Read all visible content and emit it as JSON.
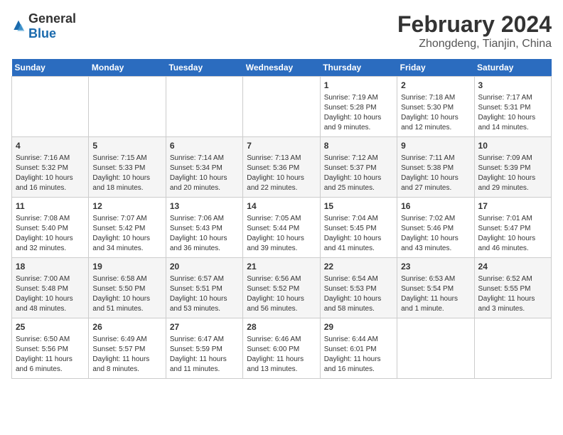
{
  "header": {
    "logo_general": "General",
    "logo_blue": "Blue",
    "title": "February 2024",
    "subtitle": "Zhongdeng, Tianjin, China"
  },
  "days_of_week": [
    "Sunday",
    "Monday",
    "Tuesday",
    "Wednesday",
    "Thursday",
    "Friday",
    "Saturday"
  ],
  "weeks": [
    [
      {
        "date": "",
        "content": ""
      },
      {
        "date": "",
        "content": ""
      },
      {
        "date": "",
        "content": ""
      },
      {
        "date": "",
        "content": ""
      },
      {
        "date": "1",
        "content": "Sunrise: 7:19 AM\nSunset: 5:28 PM\nDaylight: 10 hours\nand 9 minutes."
      },
      {
        "date": "2",
        "content": "Sunrise: 7:18 AM\nSunset: 5:30 PM\nDaylight: 10 hours\nand 12 minutes."
      },
      {
        "date": "3",
        "content": "Sunrise: 7:17 AM\nSunset: 5:31 PM\nDaylight: 10 hours\nand 14 minutes."
      }
    ],
    [
      {
        "date": "4",
        "content": "Sunrise: 7:16 AM\nSunset: 5:32 PM\nDaylight: 10 hours\nand 16 minutes."
      },
      {
        "date": "5",
        "content": "Sunrise: 7:15 AM\nSunset: 5:33 PM\nDaylight: 10 hours\nand 18 minutes."
      },
      {
        "date": "6",
        "content": "Sunrise: 7:14 AM\nSunset: 5:34 PM\nDaylight: 10 hours\nand 20 minutes."
      },
      {
        "date": "7",
        "content": "Sunrise: 7:13 AM\nSunset: 5:36 PM\nDaylight: 10 hours\nand 22 minutes."
      },
      {
        "date": "8",
        "content": "Sunrise: 7:12 AM\nSunset: 5:37 PM\nDaylight: 10 hours\nand 25 minutes."
      },
      {
        "date": "9",
        "content": "Sunrise: 7:11 AM\nSunset: 5:38 PM\nDaylight: 10 hours\nand 27 minutes."
      },
      {
        "date": "10",
        "content": "Sunrise: 7:09 AM\nSunset: 5:39 PM\nDaylight: 10 hours\nand 29 minutes."
      }
    ],
    [
      {
        "date": "11",
        "content": "Sunrise: 7:08 AM\nSunset: 5:40 PM\nDaylight: 10 hours\nand 32 minutes."
      },
      {
        "date": "12",
        "content": "Sunrise: 7:07 AM\nSunset: 5:42 PM\nDaylight: 10 hours\nand 34 minutes."
      },
      {
        "date": "13",
        "content": "Sunrise: 7:06 AM\nSunset: 5:43 PM\nDaylight: 10 hours\nand 36 minutes."
      },
      {
        "date": "14",
        "content": "Sunrise: 7:05 AM\nSunset: 5:44 PM\nDaylight: 10 hours\nand 39 minutes."
      },
      {
        "date": "15",
        "content": "Sunrise: 7:04 AM\nSunset: 5:45 PM\nDaylight: 10 hours\nand 41 minutes."
      },
      {
        "date": "16",
        "content": "Sunrise: 7:02 AM\nSunset: 5:46 PM\nDaylight: 10 hours\nand 43 minutes."
      },
      {
        "date": "17",
        "content": "Sunrise: 7:01 AM\nSunset: 5:47 PM\nDaylight: 10 hours\nand 46 minutes."
      }
    ],
    [
      {
        "date": "18",
        "content": "Sunrise: 7:00 AM\nSunset: 5:48 PM\nDaylight: 10 hours\nand 48 minutes."
      },
      {
        "date": "19",
        "content": "Sunrise: 6:58 AM\nSunset: 5:50 PM\nDaylight: 10 hours\nand 51 minutes."
      },
      {
        "date": "20",
        "content": "Sunrise: 6:57 AM\nSunset: 5:51 PM\nDaylight: 10 hours\nand 53 minutes."
      },
      {
        "date": "21",
        "content": "Sunrise: 6:56 AM\nSunset: 5:52 PM\nDaylight: 10 hours\nand 56 minutes."
      },
      {
        "date": "22",
        "content": "Sunrise: 6:54 AM\nSunset: 5:53 PM\nDaylight: 10 hours\nand 58 minutes."
      },
      {
        "date": "23",
        "content": "Sunrise: 6:53 AM\nSunset: 5:54 PM\nDaylight: 11 hours\nand 1 minute."
      },
      {
        "date": "24",
        "content": "Sunrise: 6:52 AM\nSunset: 5:55 PM\nDaylight: 11 hours\nand 3 minutes."
      }
    ],
    [
      {
        "date": "25",
        "content": "Sunrise: 6:50 AM\nSunset: 5:56 PM\nDaylight: 11 hours\nand 6 minutes."
      },
      {
        "date": "26",
        "content": "Sunrise: 6:49 AM\nSunset: 5:57 PM\nDaylight: 11 hours\nand 8 minutes."
      },
      {
        "date": "27",
        "content": "Sunrise: 6:47 AM\nSunset: 5:59 PM\nDaylight: 11 hours\nand 11 minutes."
      },
      {
        "date": "28",
        "content": "Sunrise: 6:46 AM\nSunset: 6:00 PM\nDaylight: 11 hours\nand 13 minutes."
      },
      {
        "date": "29",
        "content": "Sunrise: 6:44 AM\nSunset: 6:01 PM\nDaylight: 11 hours\nand 16 minutes."
      },
      {
        "date": "",
        "content": ""
      },
      {
        "date": "",
        "content": ""
      }
    ]
  ]
}
